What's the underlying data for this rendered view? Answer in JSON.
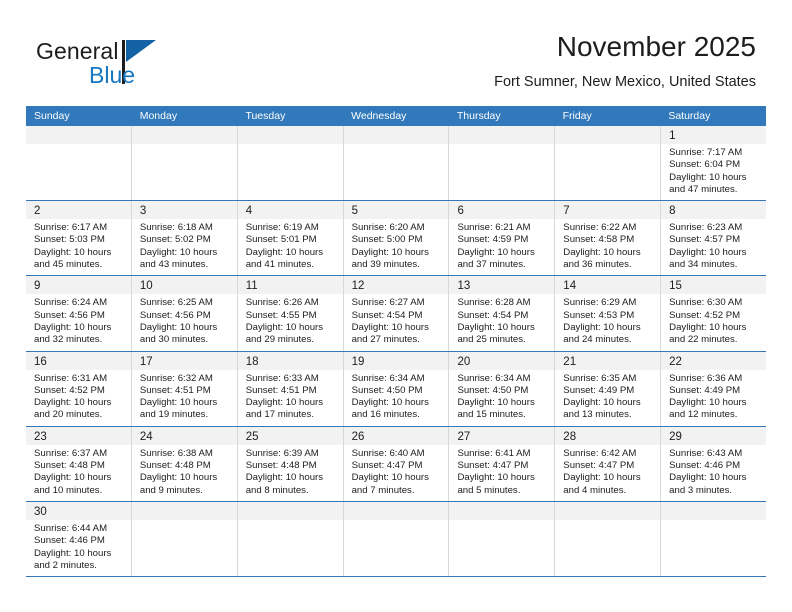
{
  "brand": {
    "word_one": "General",
    "word_two": "Blue",
    "accent_color": "#1676c0",
    "triangle_color": "#1461a6"
  },
  "header": {
    "title": "November 2025",
    "location": "Fort Sumner, New Mexico, United States"
  },
  "theme": {
    "header_row_bg": "#3179ba",
    "daynum_band_bg": "#f2f2f2",
    "row_separator": "#3179ba",
    "cell_separator": "#d8d8d8"
  },
  "calendar": {
    "weekday_headers": [
      "Sunday",
      "Monday",
      "Tuesday",
      "Wednesday",
      "Thursday",
      "Friday",
      "Saturday"
    ],
    "weeks": [
      [
        {
          "day": "",
          "empty": true,
          "sunrise": "",
          "sunset": "",
          "daylight_1": "",
          "daylight_2": ""
        },
        {
          "day": "",
          "empty": true,
          "sunrise": "",
          "sunset": "",
          "daylight_1": "",
          "daylight_2": ""
        },
        {
          "day": "",
          "empty": true,
          "sunrise": "",
          "sunset": "",
          "daylight_1": "",
          "daylight_2": ""
        },
        {
          "day": "",
          "empty": true,
          "sunrise": "",
          "sunset": "",
          "daylight_1": "",
          "daylight_2": ""
        },
        {
          "day": "",
          "empty": true,
          "sunrise": "",
          "sunset": "",
          "daylight_1": "",
          "daylight_2": ""
        },
        {
          "day": "",
          "empty": true,
          "sunrise": "",
          "sunset": "",
          "daylight_1": "",
          "daylight_2": ""
        },
        {
          "day": "1",
          "empty": false,
          "sunrise": "Sunrise: 7:17 AM",
          "sunset": "Sunset: 6:04 PM",
          "daylight_1": "Daylight: 10 hours",
          "daylight_2": "and 47 minutes."
        }
      ],
      [
        {
          "day": "2",
          "empty": false,
          "sunrise": "Sunrise: 6:17 AM",
          "sunset": "Sunset: 5:03 PM",
          "daylight_1": "Daylight: 10 hours",
          "daylight_2": "and 45 minutes."
        },
        {
          "day": "3",
          "empty": false,
          "sunrise": "Sunrise: 6:18 AM",
          "sunset": "Sunset: 5:02 PM",
          "daylight_1": "Daylight: 10 hours",
          "daylight_2": "and 43 minutes."
        },
        {
          "day": "4",
          "empty": false,
          "sunrise": "Sunrise: 6:19 AM",
          "sunset": "Sunset: 5:01 PM",
          "daylight_1": "Daylight: 10 hours",
          "daylight_2": "and 41 minutes."
        },
        {
          "day": "5",
          "empty": false,
          "sunrise": "Sunrise: 6:20 AM",
          "sunset": "Sunset: 5:00 PM",
          "daylight_1": "Daylight: 10 hours",
          "daylight_2": "and 39 minutes."
        },
        {
          "day": "6",
          "empty": false,
          "sunrise": "Sunrise: 6:21 AM",
          "sunset": "Sunset: 4:59 PM",
          "daylight_1": "Daylight: 10 hours",
          "daylight_2": "and 37 minutes."
        },
        {
          "day": "7",
          "empty": false,
          "sunrise": "Sunrise: 6:22 AM",
          "sunset": "Sunset: 4:58 PM",
          "daylight_1": "Daylight: 10 hours",
          "daylight_2": "and 36 minutes."
        },
        {
          "day": "8",
          "empty": false,
          "sunrise": "Sunrise: 6:23 AM",
          "sunset": "Sunset: 4:57 PM",
          "daylight_1": "Daylight: 10 hours",
          "daylight_2": "and 34 minutes."
        }
      ],
      [
        {
          "day": "9",
          "empty": false,
          "sunrise": "Sunrise: 6:24 AM",
          "sunset": "Sunset: 4:56 PM",
          "daylight_1": "Daylight: 10 hours",
          "daylight_2": "and 32 minutes."
        },
        {
          "day": "10",
          "empty": false,
          "sunrise": "Sunrise: 6:25 AM",
          "sunset": "Sunset: 4:56 PM",
          "daylight_1": "Daylight: 10 hours",
          "daylight_2": "and 30 minutes."
        },
        {
          "day": "11",
          "empty": false,
          "sunrise": "Sunrise: 6:26 AM",
          "sunset": "Sunset: 4:55 PM",
          "daylight_1": "Daylight: 10 hours",
          "daylight_2": "and 29 minutes."
        },
        {
          "day": "12",
          "empty": false,
          "sunrise": "Sunrise: 6:27 AM",
          "sunset": "Sunset: 4:54 PM",
          "daylight_1": "Daylight: 10 hours",
          "daylight_2": "and 27 minutes."
        },
        {
          "day": "13",
          "empty": false,
          "sunrise": "Sunrise: 6:28 AM",
          "sunset": "Sunset: 4:54 PM",
          "daylight_1": "Daylight: 10 hours",
          "daylight_2": "and 25 minutes."
        },
        {
          "day": "14",
          "empty": false,
          "sunrise": "Sunrise: 6:29 AM",
          "sunset": "Sunset: 4:53 PM",
          "daylight_1": "Daylight: 10 hours",
          "daylight_2": "and 24 minutes."
        },
        {
          "day": "15",
          "empty": false,
          "sunrise": "Sunrise: 6:30 AM",
          "sunset": "Sunset: 4:52 PM",
          "daylight_1": "Daylight: 10 hours",
          "daylight_2": "and 22 minutes."
        }
      ],
      [
        {
          "day": "16",
          "empty": false,
          "sunrise": "Sunrise: 6:31 AM",
          "sunset": "Sunset: 4:52 PM",
          "daylight_1": "Daylight: 10 hours",
          "daylight_2": "and 20 minutes."
        },
        {
          "day": "17",
          "empty": false,
          "sunrise": "Sunrise: 6:32 AM",
          "sunset": "Sunset: 4:51 PM",
          "daylight_1": "Daylight: 10 hours",
          "daylight_2": "and 19 minutes."
        },
        {
          "day": "18",
          "empty": false,
          "sunrise": "Sunrise: 6:33 AM",
          "sunset": "Sunset: 4:51 PM",
          "daylight_1": "Daylight: 10 hours",
          "daylight_2": "and 17 minutes."
        },
        {
          "day": "19",
          "empty": false,
          "sunrise": "Sunrise: 6:34 AM",
          "sunset": "Sunset: 4:50 PM",
          "daylight_1": "Daylight: 10 hours",
          "daylight_2": "and 16 minutes."
        },
        {
          "day": "20",
          "empty": false,
          "sunrise": "Sunrise: 6:34 AM",
          "sunset": "Sunset: 4:50 PM",
          "daylight_1": "Daylight: 10 hours",
          "daylight_2": "and 15 minutes."
        },
        {
          "day": "21",
          "empty": false,
          "sunrise": "Sunrise: 6:35 AM",
          "sunset": "Sunset: 4:49 PM",
          "daylight_1": "Daylight: 10 hours",
          "daylight_2": "and 13 minutes."
        },
        {
          "day": "22",
          "empty": false,
          "sunrise": "Sunrise: 6:36 AM",
          "sunset": "Sunset: 4:49 PM",
          "daylight_1": "Daylight: 10 hours",
          "daylight_2": "and 12 minutes."
        }
      ],
      [
        {
          "day": "23",
          "empty": false,
          "sunrise": "Sunrise: 6:37 AM",
          "sunset": "Sunset: 4:48 PM",
          "daylight_1": "Daylight: 10 hours",
          "daylight_2": "and 10 minutes."
        },
        {
          "day": "24",
          "empty": false,
          "sunrise": "Sunrise: 6:38 AM",
          "sunset": "Sunset: 4:48 PM",
          "daylight_1": "Daylight: 10 hours",
          "daylight_2": "and 9 minutes."
        },
        {
          "day": "25",
          "empty": false,
          "sunrise": "Sunrise: 6:39 AM",
          "sunset": "Sunset: 4:48 PM",
          "daylight_1": "Daylight: 10 hours",
          "daylight_2": "and 8 minutes."
        },
        {
          "day": "26",
          "empty": false,
          "sunrise": "Sunrise: 6:40 AM",
          "sunset": "Sunset: 4:47 PM",
          "daylight_1": "Daylight: 10 hours",
          "daylight_2": "and 7 minutes."
        },
        {
          "day": "27",
          "empty": false,
          "sunrise": "Sunrise: 6:41 AM",
          "sunset": "Sunset: 4:47 PM",
          "daylight_1": "Daylight: 10 hours",
          "daylight_2": "and 5 minutes."
        },
        {
          "day": "28",
          "empty": false,
          "sunrise": "Sunrise: 6:42 AM",
          "sunset": "Sunset: 4:47 PM",
          "daylight_1": "Daylight: 10 hours",
          "daylight_2": "and 4 minutes."
        },
        {
          "day": "29",
          "empty": false,
          "sunrise": "Sunrise: 6:43 AM",
          "sunset": "Sunset: 4:46 PM",
          "daylight_1": "Daylight: 10 hours",
          "daylight_2": "and 3 minutes."
        }
      ],
      [
        {
          "day": "30",
          "empty": false,
          "sunrise": "Sunrise: 6:44 AM",
          "sunset": "Sunset: 4:46 PM",
          "daylight_1": "Daylight: 10 hours",
          "daylight_2": "and 2 minutes."
        },
        {
          "day": "",
          "empty": true,
          "sunrise": "",
          "sunset": "",
          "daylight_1": "",
          "daylight_2": ""
        },
        {
          "day": "",
          "empty": true,
          "sunrise": "",
          "sunset": "",
          "daylight_1": "",
          "daylight_2": ""
        },
        {
          "day": "",
          "empty": true,
          "sunrise": "",
          "sunset": "",
          "daylight_1": "",
          "daylight_2": ""
        },
        {
          "day": "",
          "empty": true,
          "sunrise": "",
          "sunset": "",
          "daylight_1": "",
          "daylight_2": ""
        },
        {
          "day": "",
          "empty": true,
          "sunrise": "",
          "sunset": "",
          "daylight_1": "",
          "daylight_2": ""
        },
        {
          "day": "",
          "empty": true,
          "sunrise": "",
          "sunset": "",
          "daylight_1": "",
          "daylight_2": ""
        }
      ]
    ]
  }
}
